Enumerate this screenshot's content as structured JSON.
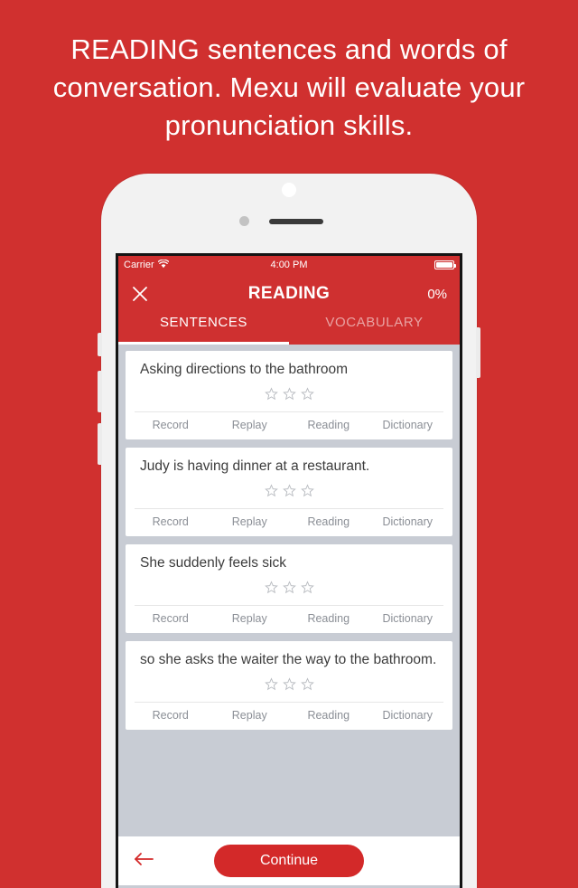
{
  "marketing": {
    "headline": "READING sentences and words of conversation. Mexu will evaluate your pronunciation skills."
  },
  "colors": {
    "brand_red": "#d0302f",
    "nav_red": "#cf3030",
    "button_red": "#d32929",
    "list_background": "#c8ccd4",
    "card_background": "#ffffff",
    "text_dark": "#3c3c3c",
    "text_muted": "#8b8f96"
  },
  "status_bar": {
    "carrier": "Carrier",
    "wifi_icon": "wifi-icon",
    "time": "4:00 PM",
    "battery_icon": "battery-icon"
  },
  "navbar": {
    "close_icon": "close-icon",
    "title": "READING",
    "progress": "0%"
  },
  "tabs": [
    {
      "label": "SENTENCES",
      "active": true
    },
    {
      "label": "VOCABULARY",
      "active": false
    }
  ],
  "card_actions": [
    "Record",
    "Replay",
    "Reading",
    "Dictionary"
  ],
  "star_rating": {
    "total": 3,
    "filled": 0,
    "icon": "star-outline-icon"
  },
  "cards": [
    {
      "text": "Asking directions to the bathroom"
    },
    {
      "text": "Judy is having dinner at a restaurant."
    },
    {
      "text": "She suddenly feels sick"
    },
    {
      "text": "so she asks the waiter the way to the bathroom."
    }
  ],
  "bottom_bar": {
    "back_icon": "arrow-left-icon",
    "continue_label": "Continue"
  }
}
